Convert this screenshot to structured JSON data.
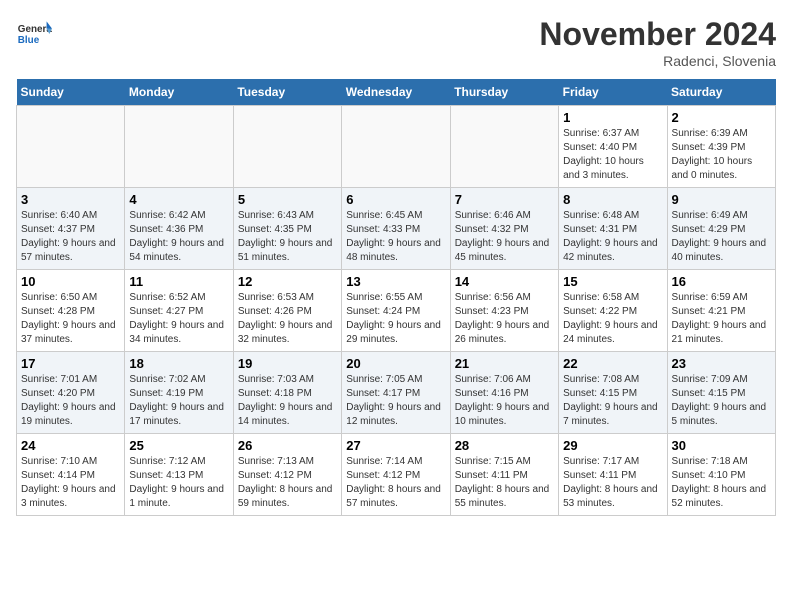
{
  "logo": {
    "general": "General",
    "blue": "Blue"
  },
  "title": "November 2024",
  "subtitle": "Radenci, Slovenia",
  "days_of_week": [
    "Sunday",
    "Monday",
    "Tuesday",
    "Wednesday",
    "Thursday",
    "Friday",
    "Saturday"
  ],
  "weeks": [
    [
      {
        "day": "",
        "sunrise": "",
        "sunset": "",
        "daylight": ""
      },
      {
        "day": "",
        "sunrise": "",
        "sunset": "",
        "daylight": ""
      },
      {
        "day": "",
        "sunrise": "",
        "sunset": "",
        "daylight": ""
      },
      {
        "day": "",
        "sunrise": "",
        "sunset": "",
        "daylight": ""
      },
      {
        "day": "",
        "sunrise": "",
        "sunset": "",
        "daylight": ""
      },
      {
        "day": "1",
        "sunrise": "Sunrise: 6:37 AM",
        "sunset": "Sunset: 4:40 PM",
        "daylight": "Daylight: 10 hours and 3 minutes."
      },
      {
        "day": "2",
        "sunrise": "Sunrise: 6:39 AM",
        "sunset": "Sunset: 4:39 PM",
        "daylight": "Daylight: 10 hours and 0 minutes."
      }
    ],
    [
      {
        "day": "3",
        "sunrise": "Sunrise: 6:40 AM",
        "sunset": "Sunset: 4:37 PM",
        "daylight": "Daylight: 9 hours and 57 minutes."
      },
      {
        "day": "4",
        "sunrise": "Sunrise: 6:42 AM",
        "sunset": "Sunset: 4:36 PM",
        "daylight": "Daylight: 9 hours and 54 minutes."
      },
      {
        "day": "5",
        "sunrise": "Sunrise: 6:43 AM",
        "sunset": "Sunset: 4:35 PM",
        "daylight": "Daylight: 9 hours and 51 minutes."
      },
      {
        "day": "6",
        "sunrise": "Sunrise: 6:45 AM",
        "sunset": "Sunset: 4:33 PM",
        "daylight": "Daylight: 9 hours and 48 minutes."
      },
      {
        "day": "7",
        "sunrise": "Sunrise: 6:46 AM",
        "sunset": "Sunset: 4:32 PM",
        "daylight": "Daylight: 9 hours and 45 minutes."
      },
      {
        "day": "8",
        "sunrise": "Sunrise: 6:48 AM",
        "sunset": "Sunset: 4:31 PM",
        "daylight": "Daylight: 9 hours and 42 minutes."
      },
      {
        "day": "9",
        "sunrise": "Sunrise: 6:49 AM",
        "sunset": "Sunset: 4:29 PM",
        "daylight": "Daylight: 9 hours and 40 minutes."
      }
    ],
    [
      {
        "day": "10",
        "sunrise": "Sunrise: 6:50 AM",
        "sunset": "Sunset: 4:28 PM",
        "daylight": "Daylight: 9 hours and 37 minutes."
      },
      {
        "day": "11",
        "sunrise": "Sunrise: 6:52 AM",
        "sunset": "Sunset: 4:27 PM",
        "daylight": "Daylight: 9 hours and 34 minutes."
      },
      {
        "day": "12",
        "sunrise": "Sunrise: 6:53 AM",
        "sunset": "Sunset: 4:26 PM",
        "daylight": "Daylight: 9 hours and 32 minutes."
      },
      {
        "day": "13",
        "sunrise": "Sunrise: 6:55 AM",
        "sunset": "Sunset: 4:24 PM",
        "daylight": "Daylight: 9 hours and 29 minutes."
      },
      {
        "day": "14",
        "sunrise": "Sunrise: 6:56 AM",
        "sunset": "Sunset: 4:23 PM",
        "daylight": "Daylight: 9 hours and 26 minutes."
      },
      {
        "day": "15",
        "sunrise": "Sunrise: 6:58 AM",
        "sunset": "Sunset: 4:22 PM",
        "daylight": "Daylight: 9 hours and 24 minutes."
      },
      {
        "day": "16",
        "sunrise": "Sunrise: 6:59 AM",
        "sunset": "Sunset: 4:21 PM",
        "daylight": "Daylight: 9 hours and 21 minutes."
      }
    ],
    [
      {
        "day": "17",
        "sunrise": "Sunrise: 7:01 AM",
        "sunset": "Sunset: 4:20 PM",
        "daylight": "Daylight: 9 hours and 19 minutes."
      },
      {
        "day": "18",
        "sunrise": "Sunrise: 7:02 AM",
        "sunset": "Sunset: 4:19 PM",
        "daylight": "Daylight: 9 hours and 17 minutes."
      },
      {
        "day": "19",
        "sunrise": "Sunrise: 7:03 AM",
        "sunset": "Sunset: 4:18 PM",
        "daylight": "Daylight: 9 hours and 14 minutes."
      },
      {
        "day": "20",
        "sunrise": "Sunrise: 7:05 AM",
        "sunset": "Sunset: 4:17 PM",
        "daylight": "Daylight: 9 hours and 12 minutes."
      },
      {
        "day": "21",
        "sunrise": "Sunrise: 7:06 AM",
        "sunset": "Sunset: 4:16 PM",
        "daylight": "Daylight: 9 hours and 10 minutes."
      },
      {
        "day": "22",
        "sunrise": "Sunrise: 7:08 AM",
        "sunset": "Sunset: 4:15 PM",
        "daylight": "Daylight: 9 hours and 7 minutes."
      },
      {
        "day": "23",
        "sunrise": "Sunrise: 7:09 AM",
        "sunset": "Sunset: 4:15 PM",
        "daylight": "Daylight: 9 hours and 5 minutes."
      }
    ],
    [
      {
        "day": "24",
        "sunrise": "Sunrise: 7:10 AM",
        "sunset": "Sunset: 4:14 PM",
        "daylight": "Daylight: 9 hours and 3 minutes."
      },
      {
        "day": "25",
        "sunrise": "Sunrise: 7:12 AM",
        "sunset": "Sunset: 4:13 PM",
        "daylight": "Daylight: 9 hours and 1 minute."
      },
      {
        "day": "26",
        "sunrise": "Sunrise: 7:13 AM",
        "sunset": "Sunset: 4:12 PM",
        "daylight": "Daylight: 8 hours and 59 minutes."
      },
      {
        "day": "27",
        "sunrise": "Sunrise: 7:14 AM",
        "sunset": "Sunset: 4:12 PM",
        "daylight": "Daylight: 8 hours and 57 minutes."
      },
      {
        "day": "28",
        "sunrise": "Sunrise: 7:15 AM",
        "sunset": "Sunset: 4:11 PM",
        "daylight": "Daylight: 8 hours and 55 minutes."
      },
      {
        "day": "29",
        "sunrise": "Sunrise: 7:17 AM",
        "sunset": "Sunset: 4:11 PM",
        "daylight": "Daylight: 8 hours and 53 minutes."
      },
      {
        "day": "30",
        "sunrise": "Sunrise: 7:18 AM",
        "sunset": "Sunset: 4:10 PM",
        "daylight": "Daylight: 8 hours and 52 minutes."
      }
    ]
  ]
}
